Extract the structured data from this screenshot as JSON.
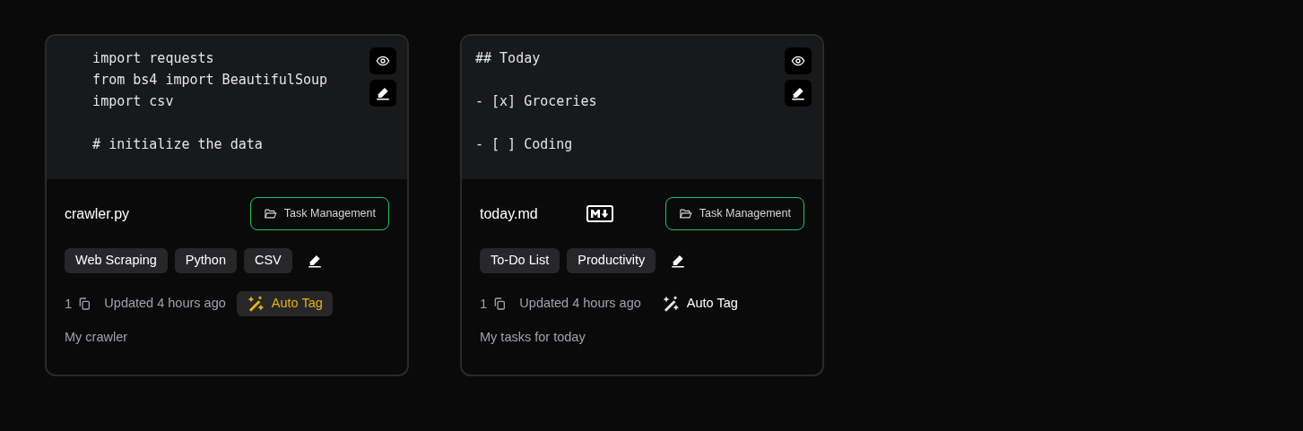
{
  "cards": [
    {
      "kind": "python",
      "code": "    import requests\n    from bs4 import BeautifulSoup\n    import csv\n\n    # initialize the data",
      "filename": "crawler.py",
      "folder": "Task Management",
      "tags": [
        "Web Scraping",
        "Python",
        "CSV"
      ],
      "count": "1",
      "updated": "Updated 4 hours ago",
      "auto_tag": {
        "label": "Auto Tag",
        "highlighted": true
      },
      "description": "My crawler"
    },
    {
      "kind": "markdown",
      "code": "## Today\n\n- [x] Groceries\n\n- [ ] Coding",
      "filename": "today.md",
      "folder": "Task Management",
      "tags": [
        "To-Do List",
        "Productivity"
      ],
      "count": "1",
      "updated": "Updated 4 hours ago",
      "auto_tag": {
        "label": "Auto Tag",
        "highlighted": false
      },
      "description": "My tasks for today"
    }
  ]
}
